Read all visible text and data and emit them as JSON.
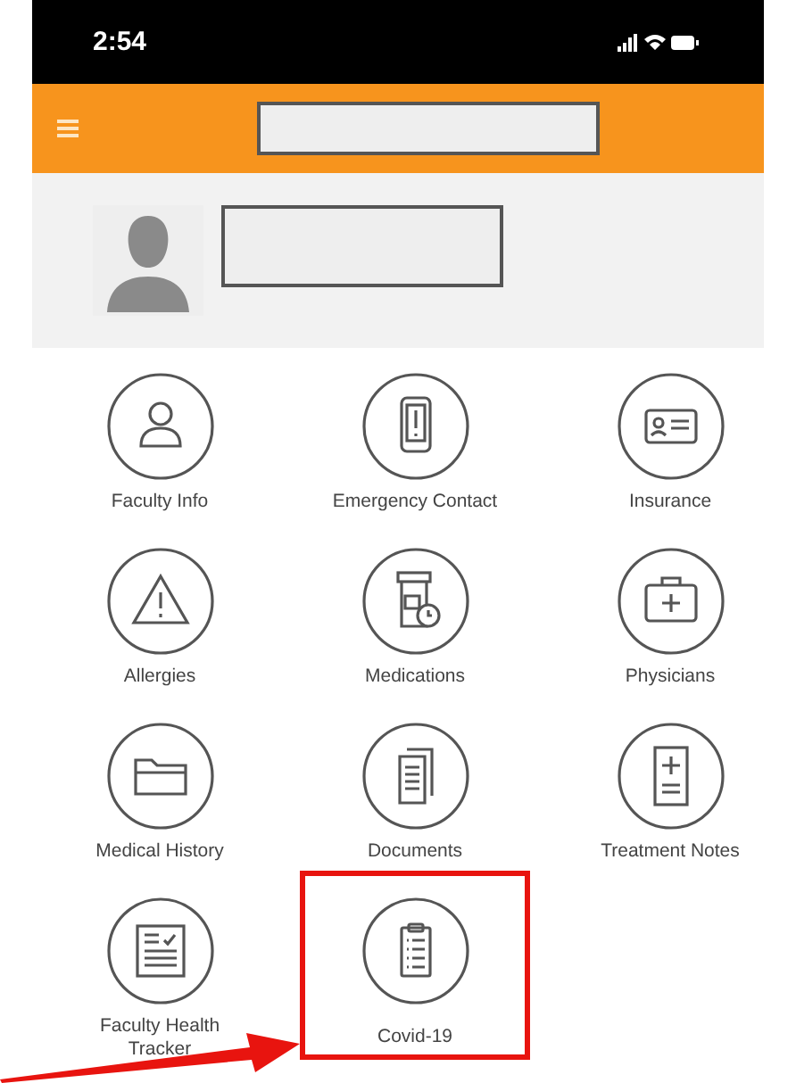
{
  "status_bar": {
    "time": "2:54"
  },
  "tiles": [
    {
      "label": "Faculty Info",
      "kind": "person",
      "highlighted": false
    },
    {
      "label": "Emergency Contact",
      "kind": "phone",
      "highlighted": false
    },
    {
      "label": "Insurance",
      "kind": "card",
      "highlighted": false
    },
    {
      "label": "Allergies",
      "kind": "warning",
      "highlighted": false
    },
    {
      "label": "Medications",
      "kind": "bottle",
      "highlighted": false
    },
    {
      "label": "Physicians",
      "kind": "kit",
      "highlighted": false
    },
    {
      "label": "Medical History",
      "kind": "folder",
      "highlighted": false
    },
    {
      "label": "Documents",
      "kind": "pages",
      "highlighted": false
    },
    {
      "label": "Treatment Notes",
      "kind": "notes",
      "highlighted": false
    },
    {
      "label": "Faculty Health Tracker",
      "kind": "checklist",
      "highlighted": false
    },
    {
      "label": "Covid-19",
      "kind": "clipboard",
      "highlighted": true
    }
  ]
}
